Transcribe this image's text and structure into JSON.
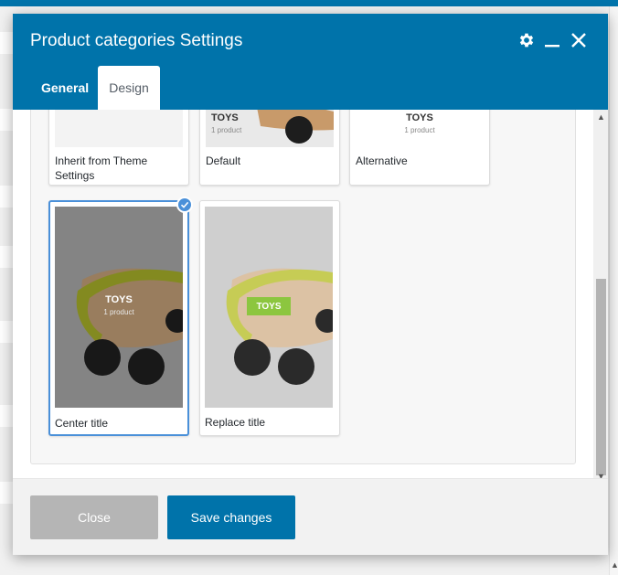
{
  "modal": {
    "title": "Product categories Settings",
    "tabs": [
      {
        "label": "General",
        "active": false
      },
      {
        "label": "Design",
        "active": true
      }
    ]
  },
  "styles": {
    "cards": [
      {
        "label": "Inherit from Theme Settings",
        "selected": false
      },
      {
        "label": "Default",
        "selected": false,
        "thumb_title": "TOYS",
        "thumb_subtitle": "1 product"
      },
      {
        "label": "Alternative",
        "selected": false,
        "thumb_title": "TOYS",
        "thumb_subtitle": "1 product"
      },
      {
        "label": "Center title",
        "selected": true,
        "thumb_title": "TOYS",
        "thumb_subtitle": "1 product"
      },
      {
        "label": "Replace title",
        "selected": false,
        "thumb_title": "TOYS"
      }
    ]
  },
  "footer": {
    "close_label": "Close",
    "save_label": "Save changes"
  },
  "colors": {
    "header_blue": "#0073aa",
    "selected_border": "#4a90d9",
    "replace_badge": "#8cc63f"
  },
  "icons": {
    "settings": "gear-icon",
    "minimize": "minimize-icon",
    "close": "close-icon",
    "selected": "check-icon"
  }
}
